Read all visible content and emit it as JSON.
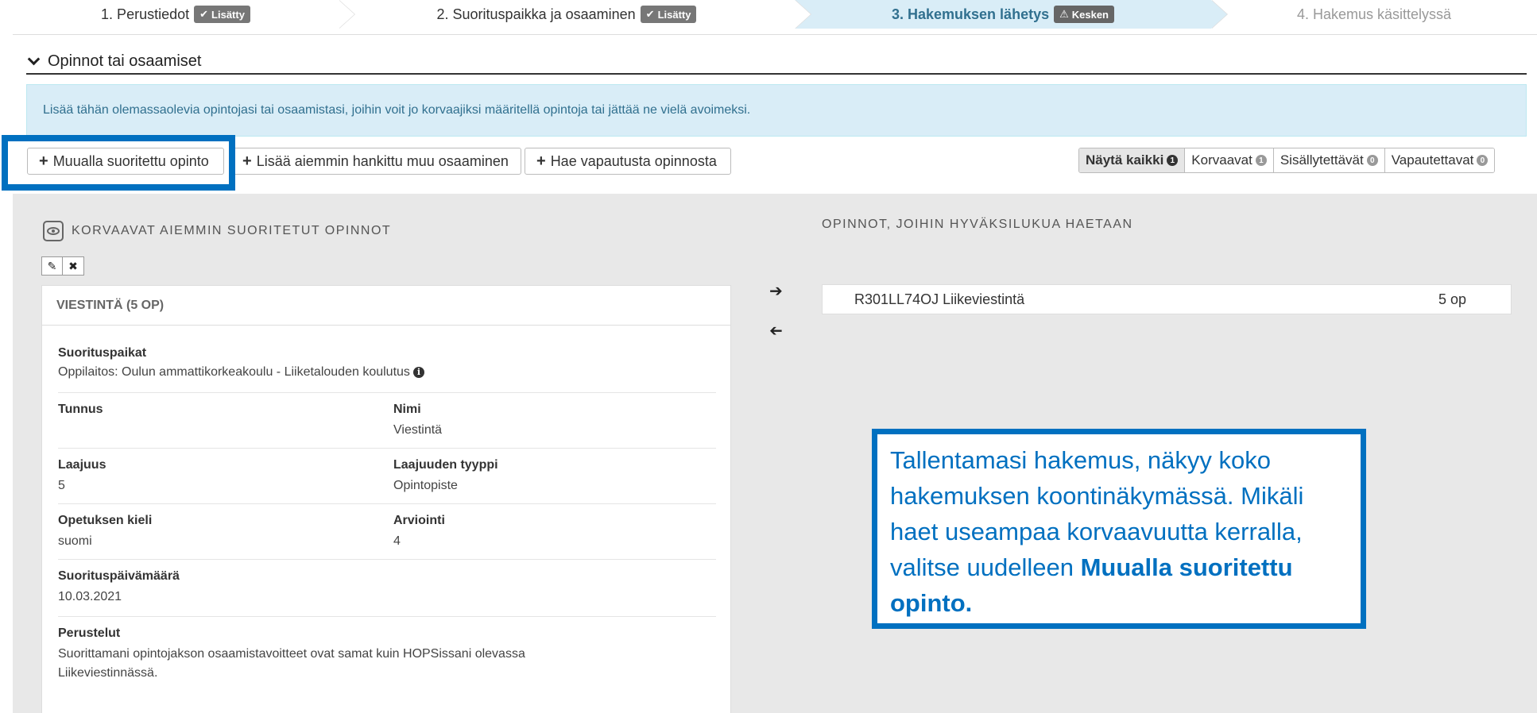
{
  "stepper": {
    "steps": [
      {
        "label": "1. Perustiedot",
        "badge": "Lisätty"
      },
      {
        "label": "2. Suorituspaikka ja osaaminen",
        "badge": "Lisätty"
      },
      {
        "label": "3. Hakemuksen lähetys",
        "badge": "Kesken"
      },
      {
        "label": "4. Hakemus käsittelyssä"
      }
    ]
  },
  "section": {
    "title": "Opinnot tai osaamiset",
    "info": "Lisää tähän olemassaolevia opintojasi tai osaamistasi, joihin voit jo korvaajiksi määritellä opintoja tai jättää ne vielä avoimeksi."
  },
  "buttons": {
    "add_external": "Muualla suoritettu opinto",
    "add_prior": "Lisää aiemmin hankittu muu osaaminen",
    "request_exemption": "Hae vapautusta opinnosta"
  },
  "filters": [
    {
      "label": "Näytä kaikki",
      "count": "1"
    },
    {
      "label": "Korvaavat",
      "count": "1"
    },
    {
      "label": "Sisällytettävät",
      "count": "0"
    },
    {
      "label": "Vapautettavat",
      "count": "0"
    }
  ],
  "left_panel": {
    "title": "KORVAAVAT AIEMMIN SUORITETUT OPINNOT",
    "card": {
      "title": "VIESTINTÄ (5 OP)",
      "suorituspaikat_label": "Suorituspaikat",
      "suorituspaikat_value": "Oppilaitos: Oulun ammattikorkeakoulu - Liiketalouden koulutus",
      "tunnus_label": "Tunnus",
      "tunnus_value": "",
      "nimi_label": "Nimi",
      "nimi_value": "Viestintä",
      "laajuus_label": "Laajuus",
      "laajuus_value": "5",
      "laajuuden_tyyppi_label": "Laajuuden tyyppi",
      "laajuuden_tyyppi_value": "Opintopiste",
      "kieli_label": "Opetuksen kieli",
      "kieli_value": "suomi",
      "arviointi_label": "Arviointi",
      "arviointi_value": "4",
      "pvm_label": "Suorituspäivämäärä",
      "pvm_value": "10.03.2021",
      "perustelut_label": "Perustelut",
      "perustelut_line1": "Suorittamani opintojakson osaamistavoitteet ovat samat kuin HOPSissani olevassa",
      "perustelut_line2": "Liikeviestinnässä."
    }
  },
  "right_panel": {
    "title": "OPINNOT, JOIHIN HYVÄKSILUKUA HAETAAN",
    "study_code_name": "R301LL74OJ Liikeviestintä",
    "study_credits": "5 op"
  },
  "callout": {
    "text_plain": "Tallentamasi hakemus, näkyy koko hakemuksen koontinäkymässä. Mikäli haet useampaa korvaavuutta kerralla, valitse uudelleen ",
    "text_bold": "Muualla suoritettu opinto."
  },
  "colors": {
    "accent": "#0070c0",
    "info_bg": "#d9edf7",
    "info_text": "#31708f"
  }
}
